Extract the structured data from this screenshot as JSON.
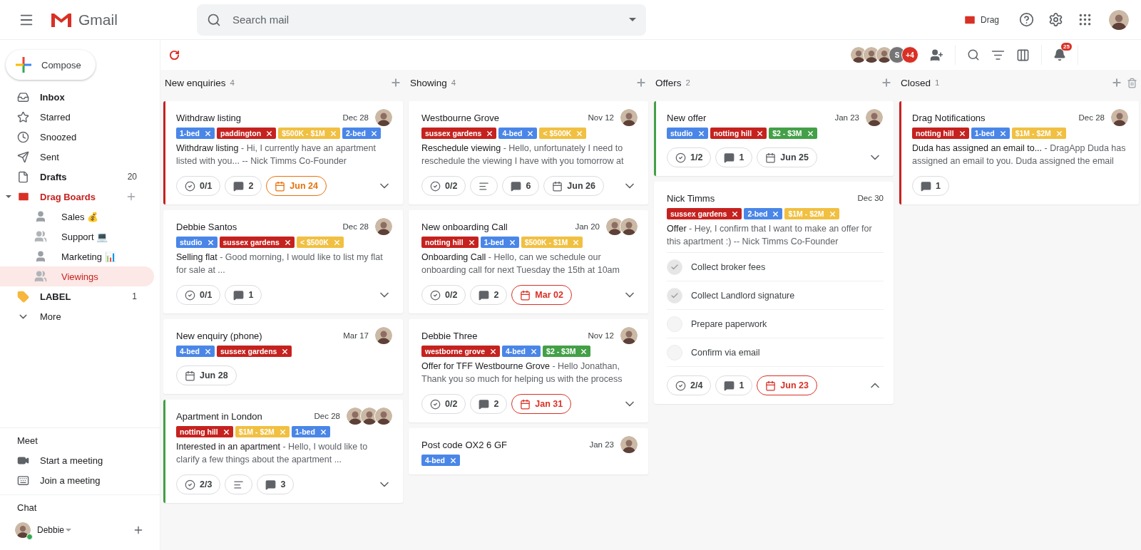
{
  "header": {
    "app_name": "Gmail",
    "search": {
      "placeholder": "Search mail"
    },
    "drag_label": "Drag"
  },
  "compose": "Compose",
  "nav": [
    {
      "label": "Inbox",
      "kind": "folder",
      "unread": true,
      "selected": false
    },
    {
      "label": "Starred",
      "kind": "folder",
      "unread": false,
      "selected": false
    },
    {
      "label": "Snoozed",
      "kind": "folder",
      "unread": false,
      "selected": false
    },
    {
      "label": "Sent",
      "kind": "folder",
      "unread": false,
      "selected": false
    },
    {
      "label": "Drafts",
      "kind": "folder",
      "unread": true,
      "selected": false,
      "count": "20"
    },
    {
      "label": "Drag Boards",
      "kind": "board",
      "unread": true,
      "selected": false,
      "expanded": true,
      "children": [
        {
          "label": "Sales 💰",
          "kind": "single",
          "selected": false
        },
        {
          "label": "Support 💻",
          "kind": "team",
          "selected": false
        },
        {
          "label": "Marketing 📊",
          "kind": "single",
          "selected": false
        },
        {
          "label": "Viewings",
          "kind": "team",
          "selected": true
        }
      ]
    },
    {
      "label": "LABEL",
      "kind": "label",
      "unread": true,
      "selected": false,
      "count": "1"
    },
    {
      "label": "More",
      "kind": "more",
      "unread": false,
      "selected": false
    }
  ],
  "meet": {
    "title": "Meet",
    "items": [
      "Start a meeting",
      "Join a meeting"
    ]
  },
  "chat": {
    "title": "Chat",
    "user": "Debbie",
    "online": true
  },
  "toolbar": {
    "members": [
      {
        "kind": "picture"
      },
      {
        "kind": "picture"
      },
      {
        "kind": "picture"
      },
      {
        "kind": "initial",
        "text": "S"
      },
      {
        "kind": "more",
        "text": "+4"
      }
    ],
    "notifications": "25"
  },
  "columns": [
    {
      "title": "New enquiries",
      "count": "4",
      "can_delete": false,
      "cards": [
        {
          "title": "Withdraw listing",
          "date": "Dec 28",
          "color": "#c5221f",
          "avatars": [
            {
              "kind": "picture"
            }
          ],
          "tags": [
            {
              "label": "1-bed",
              "color": "#4a86e8"
            },
            {
              "label": "paddington",
              "color": "#c5221f"
            },
            {
              "label": "$500K - $1M",
              "color": "#f1c042"
            },
            {
              "label": "2-bed",
              "color": "#4a86e8"
            }
          ],
          "subject": "Withdraw listing",
          "preview": "- Hi, I currently have an apartment listed with you... -- Nick Timms Co-Founder",
          "chips": [
            {
              "kind": "tasks",
              "text": "0/1"
            },
            {
              "kind": "comments",
              "text": "2"
            },
            {
              "kind": "due",
              "text": "Jun 24",
              "color": "#e8710a"
            }
          ],
          "expanded": false
        },
        {
          "title": "Debbie Santos",
          "date": "Dec 28",
          "avatars": [
            {
              "kind": "picture"
            }
          ],
          "tags": [
            {
              "label": "studio",
              "color": "#4a86e8"
            },
            {
              "label": "sussex gardens",
              "color": "#c5221f"
            },
            {
              "label": "< $500K",
              "color": "#f1c042"
            }
          ],
          "subject": "Selling flat",
          "preview": "- Good morning, I would like to list my flat for sale at ...",
          "chips": [
            {
              "kind": "tasks",
              "text": "0/1"
            },
            {
              "kind": "comments",
              "text": "1"
            }
          ],
          "expanded": false
        },
        {
          "title": "New enquiry (phone)",
          "date": "Mar 17",
          "avatars": [
            {
              "kind": "picture"
            }
          ],
          "tags": [
            {
              "label": "4-bed",
              "color": "#4a86e8"
            },
            {
              "label": "sussex gardens",
              "color": "#c5221f"
            }
          ],
          "chips": [
            {
              "kind": "due",
              "text": "Jun 28"
            }
          ]
        },
        {
          "title": "Apartment in London",
          "date": "Dec 28",
          "color": "#43a047",
          "avatars": [
            {
              "kind": "picture"
            },
            {
              "kind": "picture"
            },
            {
              "kind": "picture"
            }
          ],
          "tags": [
            {
              "label": "notting hill",
              "color": "#c5221f"
            },
            {
              "label": "$1M - $2M",
              "color": "#f1c042"
            },
            {
              "label": "1-bed",
              "color": "#4a86e8"
            }
          ],
          "subject": "Interested in an apartment",
          "preview": "- Hello, I would like to clarify a few things about the apartment ...",
          "chips": [
            {
              "kind": "tasks",
              "text": "2/3"
            },
            {
              "kind": "notes"
            },
            {
              "kind": "comments",
              "text": "3"
            }
          ],
          "expanded": false
        }
      ]
    },
    {
      "title": "Showing",
      "count": "4",
      "can_delete": false,
      "cards": [
        {
          "title": "Westbourne Grove",
          "date": "Nov 12",
          "avatars": [
            {
              "kind": "picture"
            }
          ],
          "tags": [
            {
              "label": "sussex gardens",
              "color": "#c5221f"
            },
            {
              "label": "4-bed",
              "color": "#4a86e8"
            },
            {
              "label": "< $500K",
              "color": "#f1c042"
            }
          ],
          "subject": "Reschedule viewing",
          "preview": "- Hello, unfortunately I need to reschedule the viewing I have with you tomorrow at",
          "chips": [
            {
              "kind": "tasks",
              "text": "0/2"
            },
            {
              "kind": "notes"
            },
            {
              "kind": "comments",
              "text": "6"
            },
            {
              "kind": "due",
              "text": "Jun 26"
            }
          ],
          "expanded": false
        },
        {
          "title": "New onboarding Call",
          "date": "Jan 20",
          "avatars": [
            {
              "kind": "picture"
            },
            {
              "kind": "picture"
            }
          ],
          "tags": [
            {
              "label": "notting hill",
              "color": "#c5221f"
            },
            {
              "label": "1-bed",
              "color": "#4a86e8"
            },
            {
              "label": "$500K - $1M",
              "color": "#f1c042"
            }
          ],
          "subject": "Onboarding Call",
          "preview": "- Hello, can we schedule our onboarding call for next Tuesday the 15th at 10am",
          "chips": [
            {
              "kind": "tasks",
              "text": "0/2"
            },
            {
              "kind": "comments",
              "text": "2"
            },
            {
              "kind": "due",
              "text": "Mar 02",
              "color": "#d93025"
            }
          ],
          "expanded": false
        },
        {
          "title": "Debbie Three",
          "date": "Nov 12",
          "avatars": [
            {
              "kind": "picture"
            }
          ],
          "tags": [
            {
              "label": "westborne grove",
              "color": "#c5221f"
            },
            {
              "label": "4-bed",
              "color": "#4a86e8"
            },
            {
              "label": "$2 - $3M",
              "color": "#43a047"
            }
          ],
          "subject": "Offer for TFF Westbourne Grove",
          "preview": "- Hello Jonathan, Thank you so much for helping us with the process",
          "chips": [
            {
              "kind": "tasks",
              "text": "0/2"
            },
            {
              "kind": "comments",
              "text": "2"
            },
            {
              "kind": "due",
              "text": "Jan 31",
              "color": "#d93025"
            }
          ],
          "expanded": false
        },
        {
          "title": "Post code OX2 6 GF",
          "date": "Jan 23",
          "avatars": [
            {
              "kind": "picture"
            }
          ],
          "tags": [
            {
              "label": "4-bed",
              "color": "#4a86e8"
            }
          ]
        }
      ]
    },
    {
      "title": "Offers",
      "count": "2",
      "can_delete": false,
      "cards": [
        {
          "title": "New offer",
          "date": "Jan 23",
          "color": "#43a047",
          "avatars": [
            {
              "kind": "picture"
            }
          ],
          "tags": [
            {
              "label": "studio",
              "color": "#4a86e8"
            },
            {
              "label": "notting hill",
              "color": "#c5221f"
            },
            {
              "label": "$2 - $3M",
              "color": "#43a047"
            }
          ],
          "chips": [
            {
              "kind": "tasks",
              "text": "1/2"
            },
            {
              "kind": "comments",
              "text": "1"
            },
            {
              "kind": "due",
              "text": "Jun 25"
            }
          ],
          "expanded": false
        },
        {
          "title": "Nick Timms",
          "date": "Dec 30",
          "tags": [
            {
              "label": "sussex gardens",
              "color": "#c5221f"
            },
            {
              "label": "2-bed",
              "color": "#4a86e8"
            },
            {
              "label": "$1M - $2M",
              "color": "#f1c042"
            }
          ],
          "subject": "Offer",
          "preview": "- Hey, I confirm that I want to make an offer for this apartment :) -- Nick Timms Co-Founder",
          "checklist": [
            {
              "label": "Collect broker fees",
              "checked": true
            },
            {
              "label": "Collect Landlord signature",
              "checked": true
            },
            {
              "label": "Prepare paperwork",
              "checked": false
            },
            {
              "label": "Confirm via email",
              "checked": false
            }
          ],
          "chips": [
            {
              "kind": "tasks",
              "text": "2/4"
            },
            {
              "kind": "comments",
              "text": "1"
            },
            {
              "kind": "due",
              "text": "Jun 23",
              "color": "#d93025"
            }
          ],
          "expanded": true
        }
      ]
    },
    {
      "title": "Closed",
      "count": "1",
      "can_delete": true,
      "cards": [
        {
          "title": "Drag Notifications",
          "date": "Dec 28",
          "color": "#c5221f",
          "avatars": [
            {
              "kind": "picture"
            }
          ],
          "tags": [
            {
              "label": "notting hill",
              "color": "#c5221f"
            },
            {
              "label": "1-bed",
              "color": "#4a86e8"
            },
            {
              "label": "$1M - $2M",
              "color": "#f1c042"
            }
          ],
          "subject": "Duda has assigned an email to...",
          "preview": "- DragApp Duda has assigned an email to you. Duda assigned the email",
          "chips": [
            {
              "kind": "comments",
              "text": "1"
            }
          ]
        }
      ]
    }
  ]
}
